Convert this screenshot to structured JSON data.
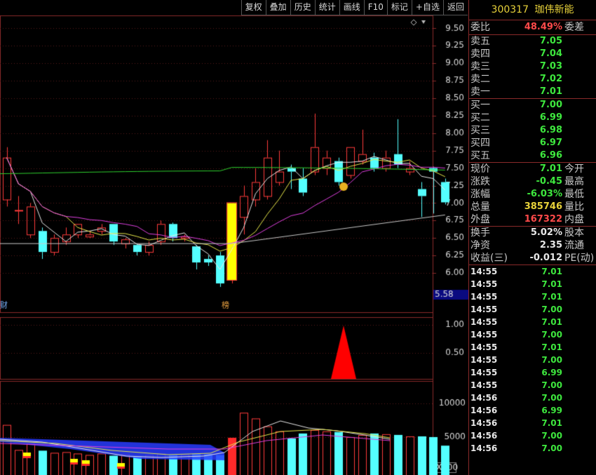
{
  "toolbar": [
    "复权",
    "叠加",
    "历史",
    "统计",
    "画线",
    "F10",
    "标记",
    "+自选",
    "返回"
  ],
  "stock": {
    "code": "300317",
    "name": "珈伟新能"
  },
  "orderbook": {
    "weibi_label": "委比",
    "weibi_value": "48.49%",
    "weicha_label": "委差",
    "asks": [
      {
        "label": "卖五",
        "price": "7.05"
      },
      {
        "label": "卖四",
        "price": "7.04"
      },
      {
        "label": "卖三",
        "price": "7.03"
      },
      {
        "label": "卖二",
        "price": "7.02"
      },
      {
        "label": "卖一",
        "price": "7.01"
      }
    ],
    "bids": [
      {
        "label": "买一",
        "price": "7.00"
      },
      {
        "label": "买二",
        "price": "6.99"
      },
      {
        "label": "买三",
        "price": "6.98"
      },
      {
        "label": "买四",
        "price": "6.97"
      },
      {
        "label": "买五",
        "price": "6.96"
      }
    ]
  },
  "quote": [
    {
      "l": "现价",
      "v": "7.01",
      "c": "green",
      "r": "今开"
    },
    {
      "l": "涨跌",
      "v": "-0.45",
      "c": "green",
      "r": "最高"
    },
    {
      "l": "涨幅",
      "v": "-6.03%",
      "c": "green",
      "r": "最低"
    },
    {
      "l": "总量",
      "v": "385746",
      "c": "yellow",
      "r": "量比"
    },
    {
      "l": "外盘",
      "v": "167322",
      "c": "red",
      "r": "内盘"
    }
  ],
  "stats": [
    {
      "l": "换手",
      "v": "5.02%",
      "r": "股本"
    },
    {
      "l": "净资",
      "v": "2.35",
      "r": "流通"
    },
    {
      "l": "收益(三)",
      "v": "-0.012",
      "r": "PE(动)"
    }
  ],
  "ticks": [
    {
      "t": "14:55",
      "p": "7.01"
    },
    {
      "t": "14:55",
      "p": "7.01"
    },
    {
      "t": "14:55",
      "p": "7.01"
    },
    {
      "t": "14:55",
      "p": "7.00"
    },
    {
      "t": "14:55",
      "p": "7.01"
    },
    {
      "t": "14:55",
      "p": "7.00"
    },
    {
      "t": "14:55",
      "p": "7.01"
    },
    {
      "t": "14:55",
      "p": "7.00"
    },
    {
      "t": "14:55",
      "p": "6.99"
    },
    {
      "t": "14:55",
      "p": "7.00"
    },
    {
      "t": "14:56",
      "p": "7.00"
    },
    {
      "t": "14:56",
      "p": "6.99"
    },
    {
      "t": "14:56",
      "p": "7.01"
    },
    {
      "t": "14:56",
      "p": "7.00"
    },
    {
      "t": "14:56",
      "p": "7.00"
    }
  ],
  "chart_data": [
    {
      "type": "candlestick",
      "ylim": [
        5.8,
        9.6
      ],
      "yticks": [
        "9.50",
        "9.25",
        "9.00",
        "8.75",
        "8.50",
        "8.25",
        "8.00",
        "7.75",
        "7.50",
        "7.25",
        "7.00",
        "6.75",
        "6.50",
        "6.25",
        "6.00"
      ],
      "last_low_label": "5.58",
      "markers": [
        {
          "text": "财"
        },
        {
          "text": "榜"
        }
      ],
      "candles": [
        {
          "o": 7.05,
          "c": 7.65,
          "h": 7.8,
          "l": 6.95
        },
        {
          "o": 6.9,
          "c": 6.9,
          "h": 7.1,
          "l": 6.7
        },
        {
          "o": 6.55,
          "c": 6.95,
          "h": 7.0,
          "l": 6.5
        },
        {
          "o": 6.6,
          "c": 6.3,
          "h": 6.65,
          "l": 6.2
        },
        {
          "o": 6.3,
          "c": 6.5,
          "h": 6.55,
          "l": 6.25
        },
        {
          "o": 6.45,
          "c": 6.55,
          "h": 6.65,
          "l": 6.4
        },
        {
          "o": 6.55,
          "c": 6.7,
          "h": 6.7,
          "l": 6.5
        },
        {
          "o": 6.52,
          "c": 6.55,
          "h": 6.6,
          "l": 6.5
        },
        {
          "o": 6.6,
          "c": 6.65,
          "h": 6.7,
          "l": 6.55
        },
        {
          "o": 6.7,
          "c": 6.45,
          "h": 6.7,
          "l": 6.4
        },
        {
          "o": 6.42,
          "c": 6.48,
          "h": 6.5,
          "l": 6.35
        },
        {
          "o": 6.4,
          "c": 6.3,
          "h": 6.42,
          "l": 6.25
        },
        {
          "o": 6.3,
          "c": 6.4,
          "h": 6.45,
          "l": 6.25
        },
        {
          "o": 6.45,
          "c": 6.7,
          "h": 6.75,
          "l": 6.4
        },
        {
          "o": 6.7,
          "c": 6.5,
          "h": 6.72,
          "l": 6.45
        },
        {
          "o": 6.5,
          "c": 6.52,
          "h": 6.55,
          "l": 6.45
        },
        {
          "o": 6.38,
          "c": 6.15,
          "h": 6.4,
          "l": 6.05
        },
        {
          "o": 6.2,
          "c": 6.15,
          "h": 6.25,
          "l": 6.1
        },
        {
          "o": 6.25,
          "c": 5.85,
          "h": 6.3,
          "l": 5.8
        },
        {
          "o": 5.9,
          "c": 7.0,
          "h": 7.0,
          "l": 5.85
        },
        {
          "o": 6.8,
          "c": 7.1,
          "h": 7.25,
          "l": 6.55
        },
        {
          "o": 7.05,
          "c": 7.3,
          "h": 7.5,
          "l": 6.95
        },
        {
          "o": 7.1,
          "c": 7.65,
          "h": 7.9,
          "l": 7.05
        },
        {
          "o": 7.3,
          "c": 7.45,
          "h": 7.75,
          "l": 7.25
        },
        {
          "o": 7.5,
          "c": 7.45,
          "h": 7.55,
          "l": 7.2
        },
        {
          "o": 7.35,
          "c": 7.15,
          "h": 7.5,
          "l": 7.1
        },
        {
          "o": 7.45,
          "c": 7.8,
          "h": 8.28,
          "l": 7.4
        },
        {
          "o": 7.5,
          "c": 7.65,
          "h": 7.75,
          "l": 7.4
        },
        {
          "o": 7.6,
          "c": 7.3,
          "h": 7.65,
          "l": 7.25
        },
        {
          "o": 7.4,
          "c": 7.8,
          "h": 7.8,
          "l": 7.35
        },
        {
          "o": 7.6,
          "c": 7.7,
          "h": 8.05,
          "l": 7.55
        },
        {
          "o": 7.65,
          "c": 7.5,
          "h": 7.72,
          "l": 7.45
        },
        {
          "o": 7.5,
          "c": 7.65,
          "h": 7.75,
          "l": 7.45
        },
        {
          "o": 7.7,
          "c": 7.55,
          "h": 8.2,
          "l": 7.5
        },
        {
          "o": 7.45,
          "c": 7.5,
          "h": 7.6,
          "l": 7.4
        },
        {
          "o": 7.2,
          "c": 7.1,
          "h": 7.3,
          "l": 6.8
        },
        {
          "o": 7.5,
          "c": 7.45,
          "h": 7.52,
          "l": 6.85
        },
        {
          "o": 7.3,
          "c": 7.01,
          "h": 7.35,
          "l": 6.98
        }
      ]
    },
    {
      "type": "indicator",
      "yticks": [
        "1.00",
        "0.50"
      ]
    },
    {
      "type": "bar",
      "yticks": [
        "10000",
        "5000"
      ],
      "unit_label": "X100"
    }
  ]
}
